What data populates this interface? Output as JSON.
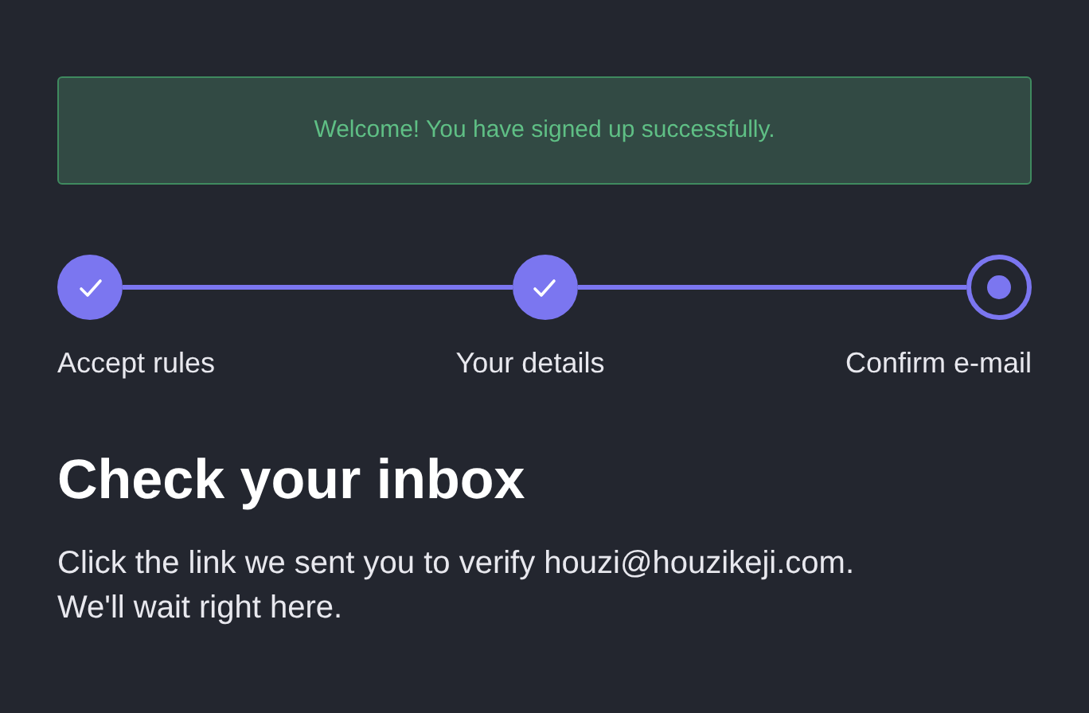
{
  "alert": {
    "text": "Welcome! You have signed up successfully."
  },
  "steps": [
    {
      "label": "Accept rules",
      "completed": true
    },
    {
      "label": "Your details",
      "completed": true
    },
    {
      "label": "Confirm e-mail",
      "completed": false
    }
  ],
  "heading": "Check your inbox",
  "message": "Click the link we sent you to verify houzi@houzikeji.com. We'll wait right here."
}
